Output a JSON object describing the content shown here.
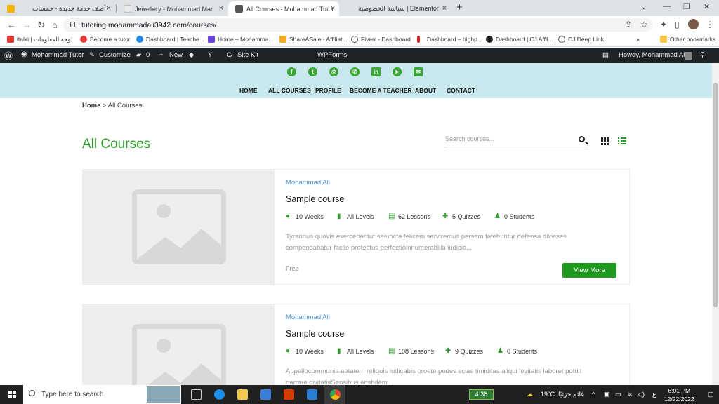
{
  "browser": {
    "tabs": [
      {
        "title": "أضف خدمة جديدة - خمسات",
        "close": "×"
      },
      {
        "title": "Jewellery - Mohammad Marketin",
        "close": "×"
      },
      {
        "title": "All Courses - Mohammad Tutor",
        "close": "×"
      },
      {
        "title": "سياسة الخصوصية | Elementor",
        "close": "×"
      }
    ],
    "new_tab": "+",
    "url": "tutoring.mohammadali3942.com/courses/",
    "bookmarks": [
      "italki | لوحة المعلومات",
      "Become a tutor",
      "Dashboard | Teache...",
      "Home – Mohamma...",
      "ShareASale - Affiliat...",
      "Fiverr - Dashboard",
      "Dashboard – highp...",
      "Dashboard | CJ Affil...",
      "CJ Deep Link"
    ],
    "more_bookmarks": "»",
    "other_bookmarks": "Other bookmarks"
  },
  "wp_admin_bar": {
    "site_name": "Mohammad Tutor",
    "customize": "Customize",
    "comments_count": "0",
    "new": "New",
    "site_kit": "Site Kit",
    "wpforms": "WPForms",
    "howdy": "Howdy, Mohammad Ali"
  },
  "header": {
    "social_icons": [
      "facebook-icon",
      "twitter-icon",
      "instagram-icon",
      "whatsapp-icon",
      "linkedin-icon",
      "telegram-icon",
      "email-icon"
    ],
    "nav": [
      "HOME",
      "ALL COURSES",
      "PROFILE",
      "BECOME A TEACHER",
      "ABOUT",
      "CONTACT"
    ]
  },
  "breadcrumb": {
    "home": "Home",
    "separator": ">",
    "current": "All Courses"
  },
  "page_title": "All Courses",
  "search": {
    "placeholder": "Search courses..."
  },
  "courses": [
    {
      "author": "Mohammad Ali",
      "title": "Sample course",
      "duration": "10 Weeks",
      "level": "All Levels",
      "lessons": "62 Lessons",
      "quizzes": "5 Quizzes",
      "students": "0 Students",
      "description": "Tyrannus quovis exercebantur seiuncta felicem serviremus persem fatebuntur defensa dixisses compensabatur facile profectus perfectiolnnumerabilia iudicio...",
      "price": "Free",
      "button": "View More"
    },
    {
      "author": "Mohammad Ali",
      "title": "Sample course",
      "duration": "10 Weeks",
      "level": "All Levels",
      "lessons": "108 Lessons",
      "quizzes": "9 Quizzes",
      "students": "0 Students",
      "description": "Appellocommunia aetatem reliquis iudicabis oroete pedes scias timiditas aliqui levitatis laboret potuit narrare civitatisSensibus aristidem..."
    }
  ],
  "taskbar": {
    "search_placeholder": "Type here to search",
    "timer": "4:38",
    "weather": "19°C",
    "weather_text": "غائم جزئيًا",
    "lang": "ع",
    "time": "6:01 PM",
    "date": "12/22/2022"
  },
  "colors": {
    "accent": "#2e9e2a",
    "header_bg": "#c9e8ee",
    "link": "#4a8fd8"
  }
}
